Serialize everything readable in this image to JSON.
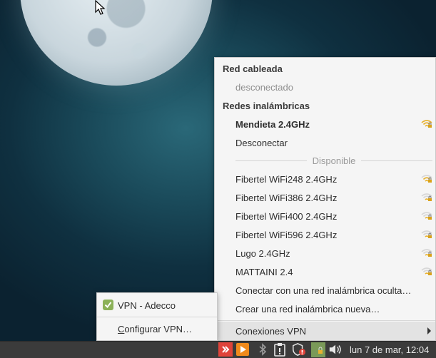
{
  "network_menu": {
    "wired_header": "Red cableada",
    "wired_status": "desconectado",
    "wireless_header": "Redes inalámbricas",
    "connected_network": "Mendieta 2.4GHz",
    "disconnect": "Desconectar",
    "available_label": "Disponible",
    "networks": [
      {
        "name": "Fibertel WiFi248 2.4GHz",
        "icon": "wifi-locked-icon"
      },
      {
        "name": "Fibertel WiFi386 2.4GHz",
        "icon": "wifi-locked-icon"
      },
      {
        "name": "Fibertel WiFi400 2.4GHz",
        "icon": "wifi-locked-icon"
      },
      {
        "name": "Fibertel WiFi596 2.4GHz",
        "icon": "wifi-locked-icon"
      },
      {
        "name": "Lugo 2.4GHz",
        "icon": "wifi-locked-icon"
      },
      {
        "name": "MATTAINI 2.4",
        "icon": "wifi-locked-icon"
      }
    ],
    "connect_hidden": "Conectar con una red inalámbrica oculta…",
    "create_new": "Crear una red inalámbrica nueva…",
    "vpn_submenu": "Conexiones VPN"
  },
  "vpn_menu": {
    "vpn_item": "VPN - Adecco",
    "vpn_checked": true,
    "configure_prefix": "",
    "configure_underlined": "C",
    "configure_rest": "onfigurar VPN…"
  },
  "panel": {
    "clock": "lun  7 de mar, 12:04",
    "tray_icons": [
      "anydesk-icon",
      "media-player-icon",
      "bluetooth-icon",
      "clipboard-icon",
      "shield-update-icon",
      "network-locked-icon",
      "volume-icon"
    ]
  },
  "colors": {
    "menu_bg": "#f5f5f5",
    "panel_bg": "#3b3b3b",
    "accent_green": "#8bb158",
    "wifi_signal": "#e8b230"
  }
}
